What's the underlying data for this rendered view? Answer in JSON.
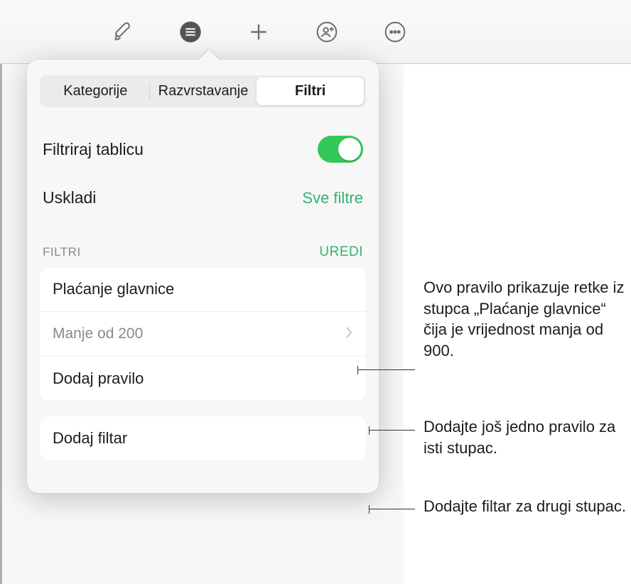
{
  "toolbar": {
    "icons": [
      "brush-icon",
      "list-circle-icon",
      "plus-icon",
      "person-add-icon",
      "more-circle-icon"
    ]
  },
  "popover": {
    "tabs": {
      "categories": "Kategorije",
      "sort": "Razvrstavanje",
      "filters": "Filtri"
    },
    "filter_table_label": "Filtriraj tablicu",
    "match_label": "Uskladi",
    "match_value": "Sve filtre",
    "section_title": "FILTRI",
    "section_action": "UREDI",
    "rule": {
      "column": "Plaćanje glavnice",
      "condition": "Manje od 200"
    },
    "add_rule": "Dodaj pravilo",
    "add_filter": "Dodaj filtar"
  },
  "callouts": {
    "rule_desc": "Ovo pravilo prikazuje retke iz stupca „Plaćanje glavnice“ čija je vrijednost manja od 900.",
    "add_rule_desc": "Dodajte još jedno pravilo za isti stupac.",
    "add_filter_desc": "Dodajte filtar za drugi stupac."
  },
  "colors": {
    "accent": "#34c759",
    "green_text": "#34b36a"
  }
}
